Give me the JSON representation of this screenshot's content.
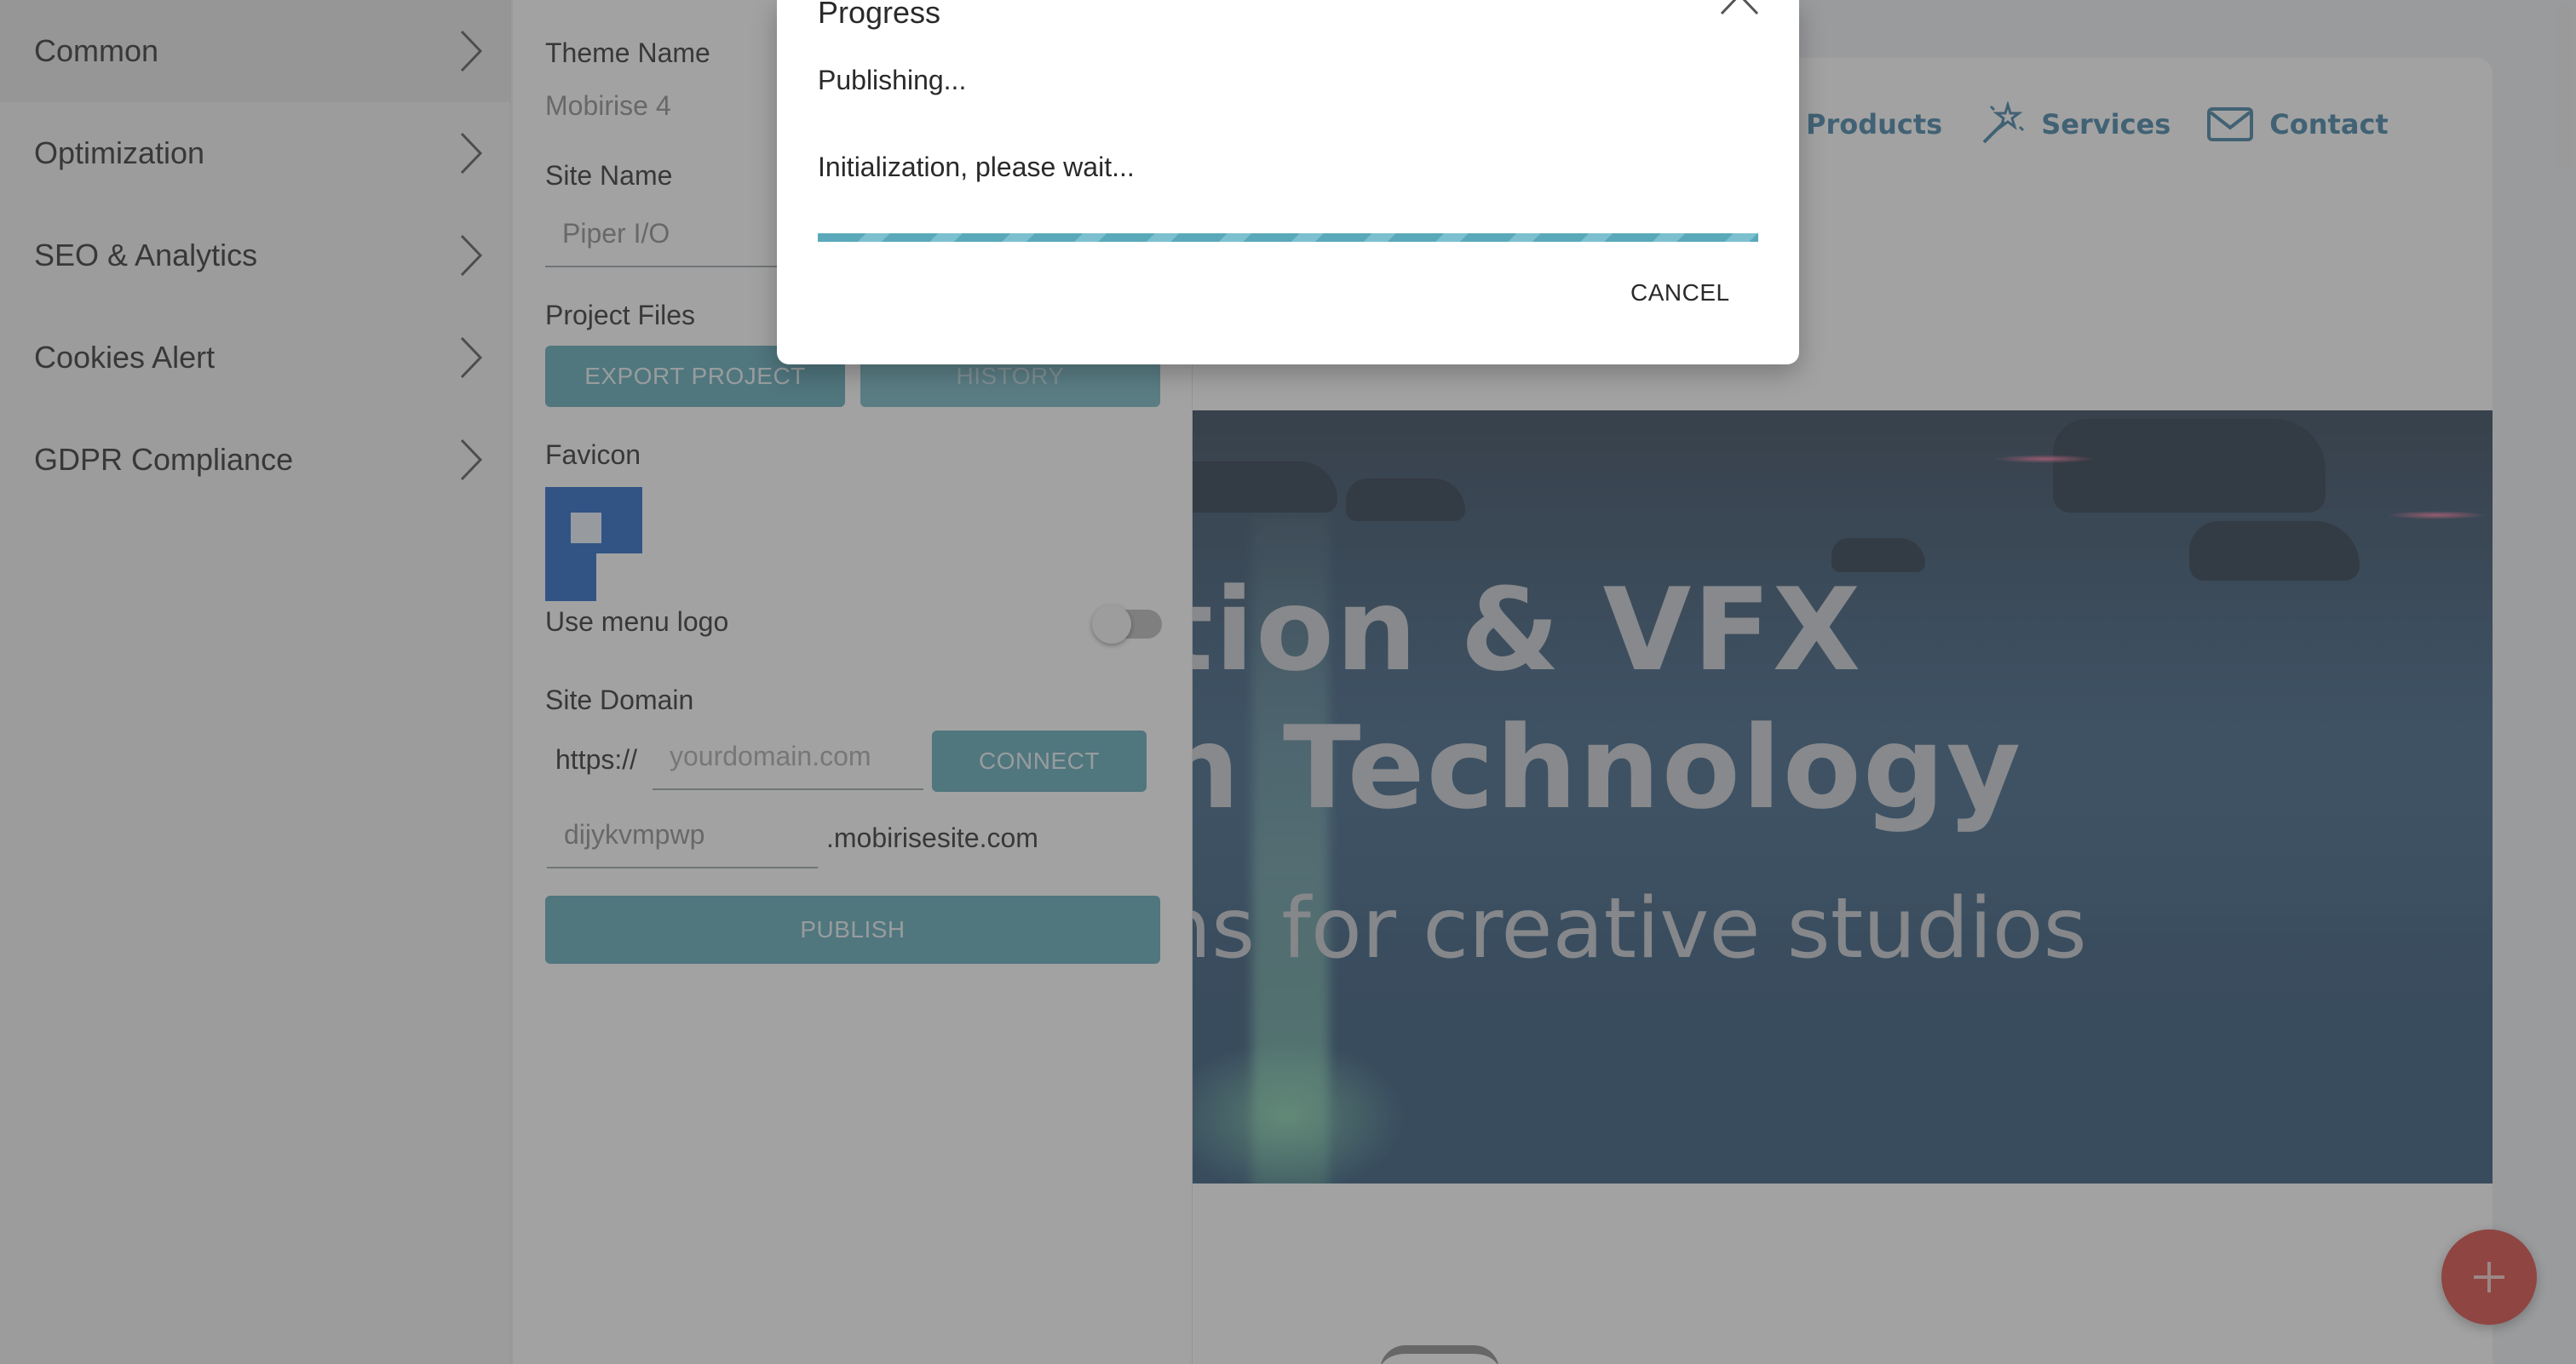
{
  "sidebar": {
    "items": [
      {
        "label": "Common"
      },
      {
        "label": "Optimization"
      },
      {
        "label": "SEO & Analytics"
      },
      {
        "label": "Cookies Alert"
      },
      {
        "label": "GDPR Compliance"
      }
    ]
  },
  "panel": {
    "theme_name_label": "Theme Name",
    "theme_name_value": "Mobirise 4",
    "site_name_label": "Site Name",
    "site_name_value": "Piper I/O",
    "project_files_label": "Project Files",
    "export_button": "EXPORT PROJECT",
    "history_button": "HISTORY",
    "favicon_label": "Favicon",
    "use_menu_logo_label": "Use menu logo",
    "use_menu_logo_on": false,
    "site_domain_label": "Site Domain",
    "domain_prefix": "https://",
    "domain_placeholder": "yourdomain.com",
    "connect_button": "CONNECT",
    "subdomain_value": "dijykvmpwp",
    "subdomain_suffix": ".mobirisesite.com",
    "publish_button": "PUBLISH"
  },
  "preview": {
    "nav": [
      {
        "label": "Products",
        "icon": "products-icon"
      },
      {
        "label": "Services",
        "icon": "magic-wand-icon"
      },
      {
        "label": "Contact",
        "icon": "envelope-icon"
      }
    ],
    "hero_line_1": "tion & VFX",
    "hero_line_2": "n Technology",
    "hero_line_3": "ns for creative studios"
  },
  "modal": {
    "title": "Progress",
    "status": "Publishing...",
    "detail": "Initialization, please wait...",
    "cancel": "CANCEL",
    "progress_fraction": 1.0
  },
  "colors": {
    "accent": "#5ba7b7",
    "nav_link": "#3d7fa3",
    "fab": "#d9443c"
  }
}
